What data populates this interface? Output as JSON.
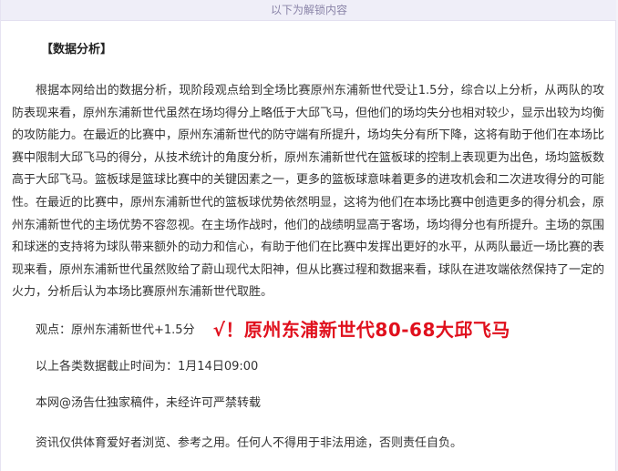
{
  "unlock_bar": {
    "text": "以下为解锁内容"
  },
  "article": {
    "section_title": "【数据分析】",
    "analysis_paragraph": "根据本网给出的数据分析，现阶段观点给到全场比赛原州东浦新世代受让1.5分，综合以上分析，从两队的攻防表现来看，原州东浦新世代虽然在场均得分上略低于大邱飞马，但他们的场均失分也相对较少，显示出较为均衡的攻防能力。在最近的比赛中，原州东浦新世代的防守端有所提升，场均失分有所下降，这将有助于他们在本场比赛中限制大邱飞马的得分，从技术统计的角度分析，原州东浦新世代在篮板球的控制上表现更为出色，场均篮板数高于大邱飞马。篮板球是篮球比赛中的关键因素之一，更多的篮板球意味着更多的进攻机会和二次进攻得分的可能性。在最近的比赛中，原州东浦新世代的篮板球优势依然明显，这将为他们在本场比赛中创造更多的得分机会，原州东浦新世代的主场优势不容忽视。在主场作战时，他们的战绩明显高于客场，场均得分也有所提升。主场的氛围和球迷的支持将为球队带来额外的动力和信心，有助于他们在比赛中发挥出更好的水平，从两队最近一场比赛的表现来看，原州东浦新世代虽然败给了蔚山现代太阳神，但从比赛过程和数据来看，球队在进攻端依然保持了一定的火力，分析后认为本场比赛原州东浦新世代取胜。",
    "viewpoint_label": "观点：原州东浦新世代+1.5分",
    "result_text": "√！原州东浦新世代80-68大邱飞马",
    "data_cutoff": "以上各类数据截止时间为：1月14日09:00",
    "copyright_notice": "本网@汤告仕独家稿件，未经许可严禁转载",
    "disclaimer": "资讯仅供体育爱好者浏览、参考之用。任何人不得用于非法用途，否则责任自负。"
  },
  "colors": {
    "unlock_bar_bg": "#efeef8",
    "unlock_bar_text": "#8a84a8",
    "result_red": "#e0101d",
    "body_text": "#333333"
  }
}
